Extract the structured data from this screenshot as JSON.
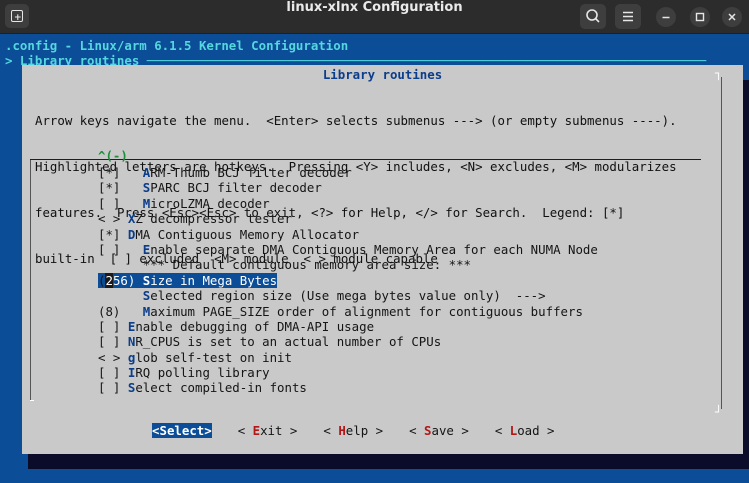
{
  "window": {
    "title": "linux-xlnx Configuration"
  },
  "header": {
    "line1": ".config - Linux/arm 6.1.5 Kernel Configuration",
    "line2": "> Library routines ───────────────────────────────────────────────────────────────────────────"
  },
  "dialog": {
    "title": "Library routines",
    "help": [
      "Arrow keys navigate the menu.  <Enter> selects submenus ---> (or empty submenus ----).",
      "Highlighted letters are hotkeys.  Pressing <Y> includes, <N> excludes, <M> modularizes",
      "features.  Press <Esc><Esc> to exit, <?> for Help, </> for Search.  Legend: [*]",
      "built-in  [ ] excluded  <M> module  < > module capable"
    ],
    "more_above": "^(-)",
    "items": [
      {
        "pre": "[*]   ",
        "hotkey": "A",
        "rest": "RM-Thumb BCJ filter decoder"
      },
      {
        "pre": "[*]   ",
        "hotkey": "S",
        "rest": "PARC BCJ filter decoder"
      },
      {
        "pre": "[ ]   ",
        "hotkey": "M",
        "rest": "icroLZMA decoder"
      },
      {
        "pre": "< > ",
        "hotkey": "X",
        "rest": "Z decompressor tester"
      },
      {
        "pre": "[*] ",
        "hotkey": "D",
        "rest": "MA Contiguous Memory Allocator"
      },
      {
        "pre": "[ ]   ",
        "hotkey": "E",
        "rest": "nable separate DMA Contiguous Memory Area for each NUMA Node"
      },
      {
        "pre": "      ",
        "hotkey": "",
        "rest": "*** Default contiguous memory area size: ***"
      },
      {
        "pre": "(256) ",
        "hotkey": "S",
        "rest": "ize in Mega Bytes",
        "selected": true
      },
      {
        "pre": "      ",
        "hotkey": "S",
        "rest": "elected region size (Use mega bytes value only)  --->"
      },
      {
        "pre": "(8)   ",
        "hotkey": "M",
        "rest": "aximum PAGE_SIZE order of alignment for contiguous buffers"
      },
      {
        "pre": "[ ] ",
        "hotkey": "E",
        "rest": "nable debugging of DMA-API usage"
      },
      {
        "pre": "[ ] ",
        "hotkey": "N",
        "rest": "R_CPUS is set to an actual number of CPUs"
      },
      {
        "pre": "< > ",
        "hotkey": "g",
        "rest": "lob self-test on init"
      },
      {
        "pre": "[ ] ",
        "hotkey": "I",
        "rest": "RQ polling library"
      },
      {
        "pre": "[ ] ",
        "hotkey": "S",
        "rest": "elect compiled-in fonts"
      }
    ],
    "buttons": [
      {
        "pre": "<",
        "hotkey": "S",
        "rest": "elect>",
        "active": true
      },
      {
        "pre": "< ",
        "hotkey": "E",
        "rest": "xit >"
      },
      {
        "pre": "< ",
        "hotkey": "H",
        "rest": "elp >"
      },
      {
        "pre": "< ",
        "hotkey": "S",
        "rest": "ave >"
      },
      {
        "pre": "< ",
        "hotkey": "L",
        "rest": "oad >"
      }
    ]
  },
  "icons": {
    "new_tab": "new-tab-icon",
    "search": "search-icon",
    "menu": "hamburger-menu-icon",
    "minimize": "minimize-icon",
    "maximize": "maximize-icon",
    "close": "close-icon"
  },
  "colors": {
    "terminal_bg": "#0b4d97",
    "dialog_bg": "#c9c9c9",
    "hotkey": "#0b3d8a",
    "button_hotkey": "#b01818",
    "header_text": "#55d7df"
  }
}
